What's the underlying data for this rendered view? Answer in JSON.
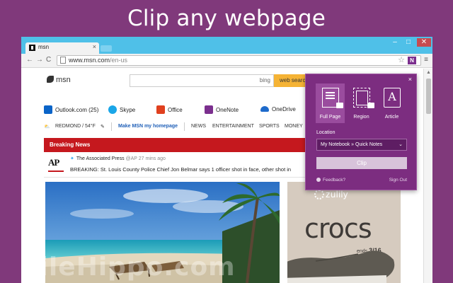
{
  "headline": "Clip any webpage",
  "browser": {
    "tab_title": "msn",
    "tab_close": "×",
    "window_controls": {
      "minimize": "–",
      "maximize": "□",
      "close": "✕"
    },
    "nav": {
      "back": "←",
      "forward": "→",
      "reload": "C"
    },
    "address_host": "www.msn.com",
    "address_path": "/en-us",
    "star_icon": "☆",
    "onenote_ext": "N",
    "menu_icon": "≡"
  },
  "msn": {
    "logo_text": "msn",
    "search_brand": "bing",
    "search_button": "web search",
    "quicklinks": [
      {
        "label": "Outlook.com (25)",
        "color": "#0A64C8"
      },
      {
        "label": "Skype",
        "color": "#1AA6E8"
      },
      {
        "label": "Office",
        "color": "#E0401E"
      },
      {
        "label": "OneNote",
        "color": "#7B2F8E"
      },
      {
        "label": "OneDrive",
        "color": "#1E6ACB"
      }
    ],
    "weather": "REDMOND / 54°F",
    "make_home": "Make MSN my homepage",
    "nav_items": [
      "NEWS",
      "ENTERTAINMENT",
      "SPORTS",
      "MONEY"
    ],
    "breaking_label": "Breaking News",
    "tweet": {
      "source": "The Associated Press",
      "handle": "@AP 27 mins ago",
      "text": "BREAKING: St. Louis County Police Chief Jon Belmar says 1 officer shot in face, other shot in"
    },
    "ad": {
      "brand": "zulily",
      "product": "crocs",
      "ends_prefix": "ends",
      "ends_date": "3/16"
    }
  },
  "clipper": {
    "close": "×",
    "modes": [
      {
        "label": "Full Page",
        "selected": true
      },
      {
        "label": "Region",
        "selected": false
      },
      {
        "label": "Article",
        "selected": false
      }
    ],
    "article_glyph": "A",
    "location_label": "Location",
    "location_value": "My Notebook » Quick Notes",
    "dropdown_icon": "⌄",
    "clip_button": "Clip",
    "feedback": "Feedback?",
    "sign_out": "Sign Out"
  },
  "watermark": "FileHippo.com"
}
